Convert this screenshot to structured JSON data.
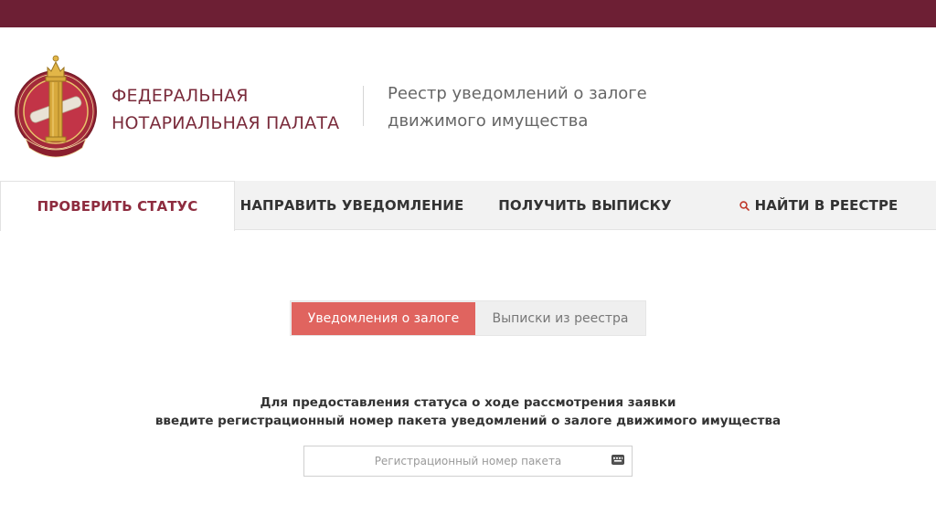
{
  "header": {
    "brand_line1": "ФЕДЕРАЛЬНАЯ",
    "brand_line2": "НОТАРИАЛЬНАЯ ПАЛАТА",
    "registry_line1": "Реестр уведомлений о залоге",
    "registry_line2": "движимого имущества",
    "logo_icon": "notary-emblem-icon"
  },
  "nav": {
    "tabs": [
      {
        "label": "ПРОВЕРИТЬ СТАТУС",
        "active": true
      },
      {
        "label": "НАПРАВИТЬ УВЕДОМЛЕНИЕ",
        "active": false
      },
      {
        "label": "ПОЛУЧИТЬ ВЫПИСКУ",
        "active": false
      },
      {
        "label": "НАЙТИ В РЕЕСТРЕ",
        "active": false,
        "icon": "search-icon"
      }
    ]
  },
  "segmented": {
    "options": [
      {
        "label": "Уведомления о залоге",
        "active": true
      },
      {
        "label": "Выписки из реестра",
        "active": false
      }
    ]
  },
  "instructions": {
    "line1": "Для предоставления статуса о ходе рассмотрения заявки",
    "line2": "введите регистрационный номер пакета уведомлений о залоге движимого имущества"
  },
  "search": {
    "placeholder": "Регистрационный номер пакета",
    "value": "",
    "icon": "keyboard-icon"
  },
  "colors": {
    "topbar": "#6d1f34",
    "brand": "#7a2b3b",
    "active_tab_text": "#8e2c3f",
    "accent": "#e0645f"
  }
}
